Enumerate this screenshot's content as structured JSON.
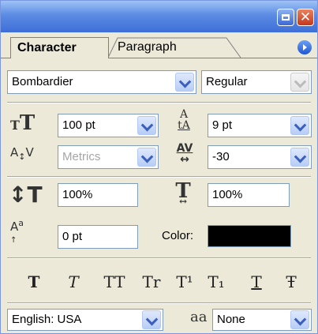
{
  "tabs": {
    "character": "Character",
    "paragraph": "Paragraph"
  },
  "font": {
    "family": "Bombardier",
    "style": "Regular"
  },
  "font_size": "100 pt",
  "leading": "9 pt",
  "kerning": "Metrics",
  "tracking": "-30",
  "vertical_scale": "100%",
  "horizontal_scale": "100%",
  "baseline_shift": "0 pt",
  "color": {
    "label": "Color:",
    "value": "#000000"
  },
  "style_buttons": [
    "T",
    "T",
    "TT",
    "Tr",
    "T¹",
    "T₁",
    "T",
    "Ŧ"
  ],
  "language": "English: USA",
  "anti_alias": {
    "icon_text": "aa",
    "value": "None"
  }
}
